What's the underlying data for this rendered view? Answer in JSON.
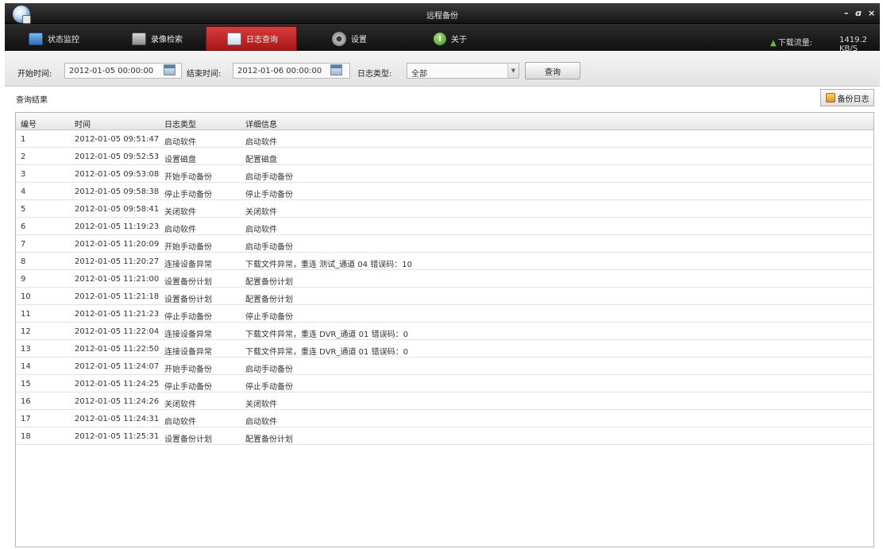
{
  "window": {
    "title": "远程备份",
    "minimize": "–",
    "maximize": "ɑ",
    "close": "×"
  },
  "nav": {
    "tabs": [
      {
        "label": "状态监控",
        "icon": "monitor-icon"
      },
      {
        "label": "录像检索",
        "icon": "video-search-icon"
      },
      {
        "label": "日志查询",
        "icon": "log-icon",
        "active": true
      },
      {
        "label": "设置",
        "icon": "gear-icon"
      },
      {
        "label": "关于",
        "icon": "info-icon"
      }
    ],
    "download_label": "下载流量:",
    "download_value": "1419.2 KB/S"
  },
  "filters": {
    "start_label": "开始时间:",
    "start_value": "2012-01-05 00:00:00",
    "end_label": "结束时间:",
    "end_value": "2012-01-06 00:00:00",
    "type_label": "日志类型:",
    "type_value": "全部",
    "query_button": "查询"
  },
  "results": {
    "label": "查询结果",
    "backup_button": "备份日志",
    "columns": [
      "编号",
      "时间",
      "日志类型",
      "详细信息"
    ],
    "rows": [
      [
        "1",
        "2012-01-05 09:51:47",
        "启动软件",
        "启动软件"
      ],
      [
        "2",
        "2012-01-05 09:52:53",
        "设置磁盘",
        "配置磁盘"
      ],
      [
        "3",
        "2012-01-05 09:53:08",
        "开始手动备份",
        "启动手动备份"
      ],
      [
        "4",
        "2012-01-05 09:58:38",
        "停止手动备份",
        "停止手动备份"
      ],
      [
        "5",
        "2012-01-05 09:58:41",
        "关闭软件",
        "关闭软件"
      ],
      [
        "6",
        "2012-01-05 11:19:23",
        "启动软件",
        "启动软件"
      ],
      [
        "7",
        "2012-01-05 11:20:09",
        "开始手动备份",
        "启动手动备份"
      ],
      [
        "8",
        "2012-01-05 11:20:27",
        "连接设备异常",
        "下载文件异常，重连 测试_通道 04 错误码：10"
      ],
      [
        "9",
        "2012-01-05 11:21:00",
        "设置备份计划",
        "配置备份计划"
      ],
      [
        "10",
        "2012-01-05 11:21:18",
        "设置备份计划",
        "配置备份计划"
      ],
      [
        "11",
        "2012-01-05 11:21:23",
        "停止手动备份",
        "停止手动备份"
      ],
      [
        "12",
        "2012-01-05 11:22:04",
        "连接设备异常",
        "下载文件异常，重连 DVR_通道 01 错误码：0"
      ],
      [
        "13",
        "2012-01-05 11:22:50",
        "连接设备异常",
        "下载文件异常，重连 DVR_通道 01 错误码：0"
      ],
      [
        "14",
        "2012-01-05 11:24:07",
        "开始手动备份",
        "启动手动备份"
      ],
      [
        "15",
        "2012-01-05 11:24:25",
        "停止手动备份",
        "停止手动备份"
      ],
      [
        "16",
        "2012-01-05 11:24:26",
        "关闭软件",
        "关闭软件"
      ],
      [
        "17",
        "2012-01-05 11:24:31",
        "启动软件",
        "启动软件"
      ],
      [
        "18",
        "2012-01-05 11:25:31",
        "设置备份计划",
        "配置备份计划"
      ]
    ]
  }
}
